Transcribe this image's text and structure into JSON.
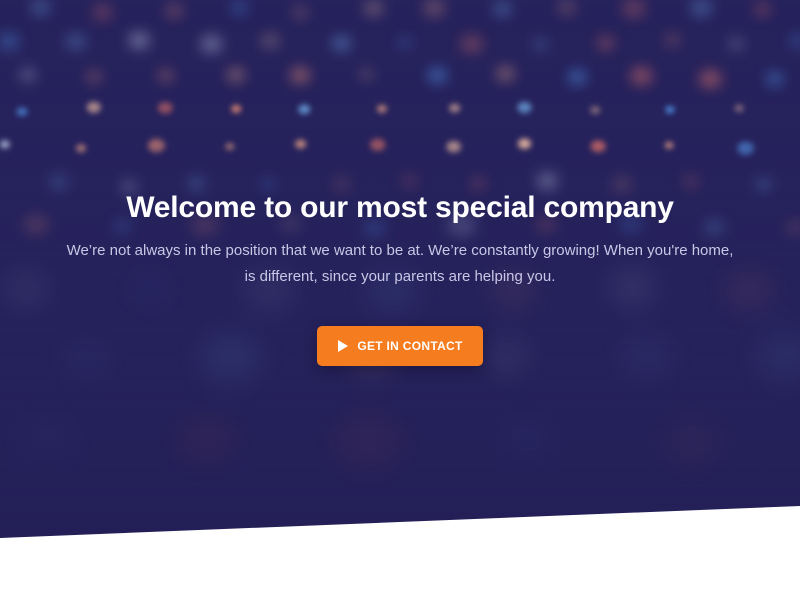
{
  "hero": {
    "title": "Welcome to our most special company",
    "subtitle": "We’re not always in the position that we want to be at. We’re constantly growing! When you're home, is different, since your parents are helping you.",
    "cta_label": "GET IN CONTACT",
    "cta_icon": "play-icon",
    "background_color": "#25215a",
    "accent_color": "#f57c1f"
  }
}
